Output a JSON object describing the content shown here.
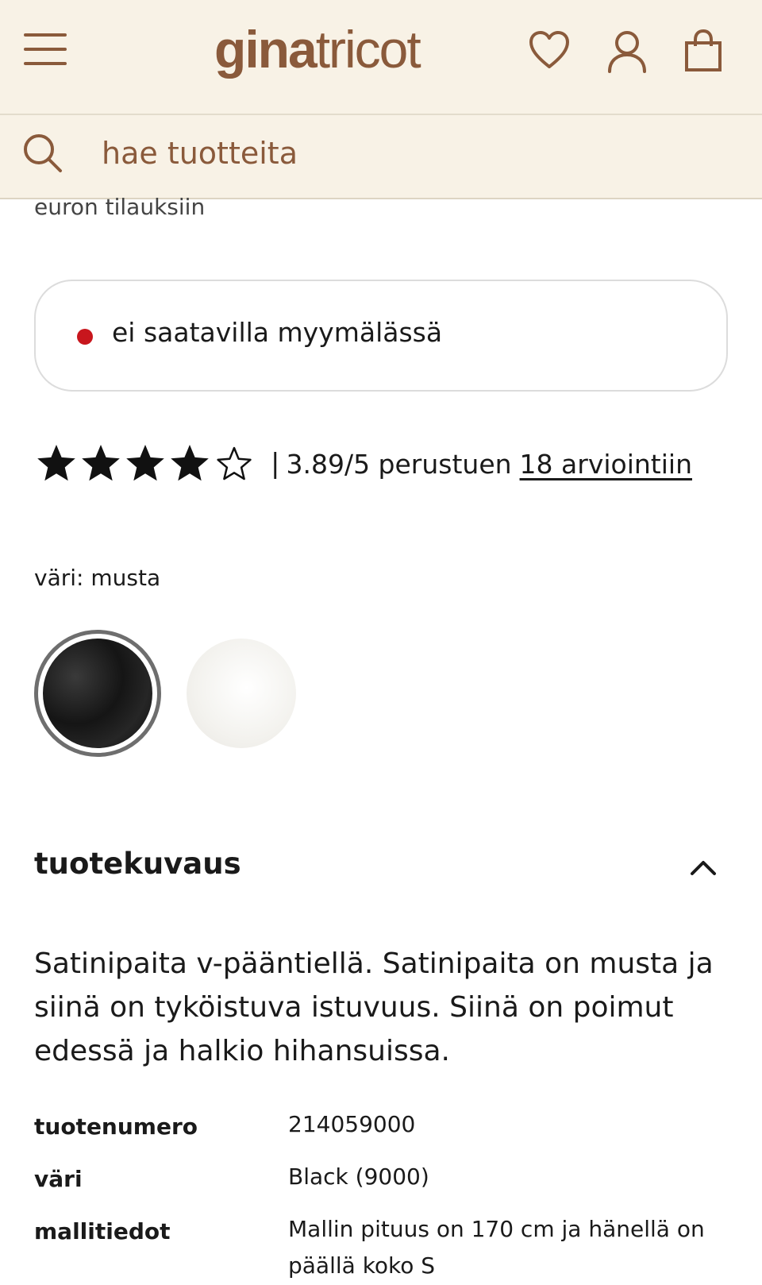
{
  "header": {
    "logo_bold": "gina",
    "logo_light": "tricot",
    "icons": [
      "menu-icon",
      "heart-icon",
      "user-icon",
      "bag-icon"
    ],
    "brand_color": "#8a5a3b",
    "background_color": "#f8f2e6"
  },
  "search": {
    "placeholder": "hae tuotteita",
    "icon": "search-icon"
  },
  "shipping": {
    "tail_text": "euron tilauksiin"
  },
  "store_availability": {
    "text": "ei saatavilla myymälässä",
    "status_color": "#c8161d"
  },
  "rating": {
    "score": 3.89,
    "max": 5,
    "filled_stars": 4,
    "separator": "|",
    "summary": "3.89/5 perustuen",
    "reviews_link": "18 arviointiin"
  },
  "color": {
    "label": "väri: musta",
    "swatches": [
      {
        "name": "musta",
        "selected": true
      },
      {
        "name": "valkoinen",
        "selected": false
      }
    ]
  },
  "description": {
    "title": "tuotekuvaus",
    "expanded": true,
    "text": "Satinipaita v-pääntiellä. Satinipaita on musta ja siinä on tyköistuva istuvuus. Siinä on poimut edessä ja halkio hihansuissa."
  },
  "specs": [
    {
      "key": "tuotenumero",
      "value": "214059000"
    },
    {
      "key": "väri",
      "value": "Black (9000)"
    },
    {
      "key": "mallitiedot",
      "value": "Mallin pituus on 170 cm ja hänellä on päällä koko S"
    }
  ]
}
